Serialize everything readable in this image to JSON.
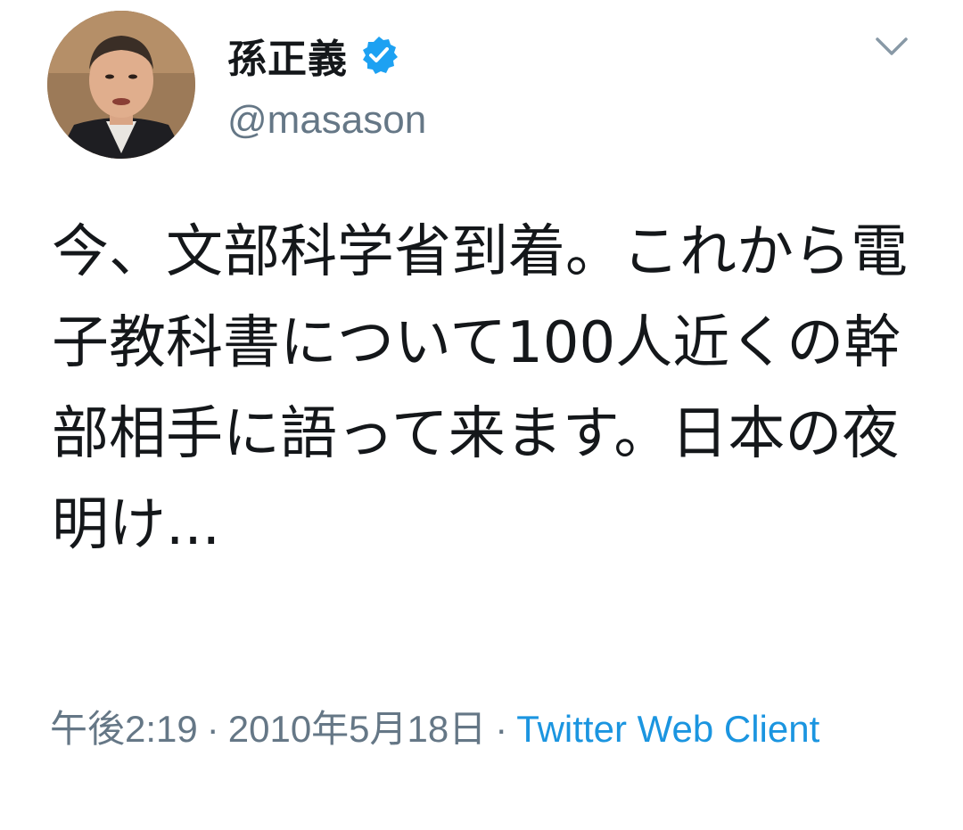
{
  "tweet": {
    "author": {
      "display_name": "孫正義",
      "handle": "@masason",
      "verified": true
    },
    "text": "今、文部科学省到着。これから電子教科書について100人近くの幹部相手に語って来ます。日本の夜明け...",
    "time": "午後2:19",
    "date": "2010年5月18日",
    "separator": "·",
    "source": "Twitter Web Client"
  },
  "colors": {
    "text_primary": "#14171a",
    "text_secondary": "#657786",
    "link": "#1b95e0",
    "verified_badge": "#1da1f2"
  },
  "icons": {
    "verified": "verified-badge-icon",
    "menu": "chevron-down-icon"
  }
}
